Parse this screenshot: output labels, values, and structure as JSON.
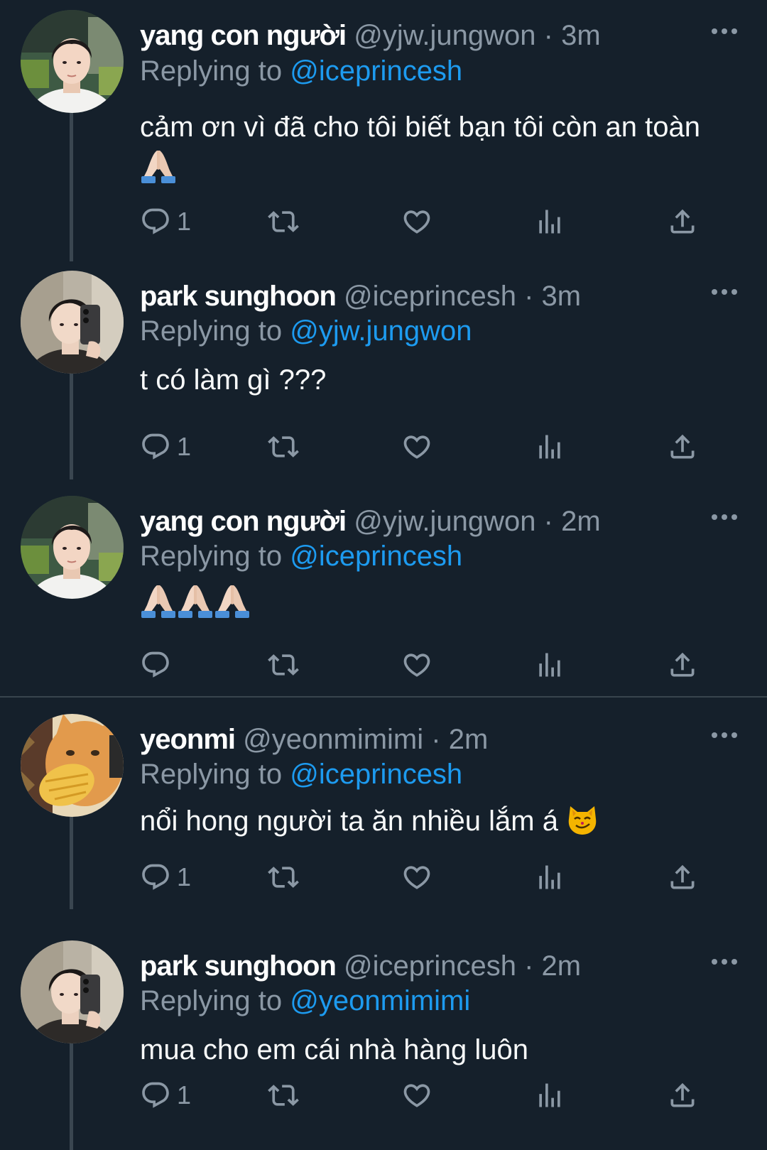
{
  "colors": {
    "background": "#15202b",
    "secondary_text": "#8b98a5",
    "mention": "#1d9bf0",
    "thread_line": "#3a4650"
  },
  "tweets": [
    {
      "display_name": "yang con người",
      "handle": "@yjw.jungwon",
      "separator": "·",
      "time": "3m",
      "replying_prefix": "Replying to",
      "replying_to": "@iceprincesh",
      "text": "cảm ơn vì đã cho tôi biết bạn tôi còn an toàn",
      "emoji": [
        "folded-hands"
      ],
      "reply_count": "1",
      "avatar": "jungwon-avatar"
    },
    {
      "display_name": "park sunghoon",
      "handle": "@iceprincesh",
      "separator": "·",
      "time": "3m",
      "replying_prefix": "Replying to",
      "replying_to": "@yjw.jungwon",
      "text": "t có làm gì ???",
      "reply_count": "1",
      "avatar": "sunghoon-avatar"
    },
    {
      "display_name": "yang con người",
      "handle": "@yjw.jungwon",
      "separator": "·",
      "time": "2m",
      "replying_prefix": "Replying to",
      "replying_to": "@iceprincesh",
      "text": "",
      "emoji": [
        "folded-hands",
        "folded-hands",
        "folded-hands"
      ],
      "reply_count": "",
      "avatar": "jungwon-avatar"
    },
    {
      "display_name": "yeonmi",
      "handle": "@yeonmimimi",
      "separator": "·",
      "time": "2m",
      "replying_prefix": "Replying to",
      "replying_to": "@iceprincesh",
      "text": "nổi hong người ta ăn nhiều lắm á",
      "emoji": [
        "smirking-cat"
      ],
      "reply_count": "1",
      "avatar": "cat-avatar"
    },
    {
      "display_name": "park sunghoon",
      "handle": "@iceprincesh",
      "separator": "·",
      "time": "2m",
      "replying_prefix": "Replying to",
      "replying_to": "@yeonmimimi",
      "text": "mua cho em cái nhà hàng luôn",
      "reply_count": "1",
      "avatar": "sunghoon-avatar"
    }
  ]
}
